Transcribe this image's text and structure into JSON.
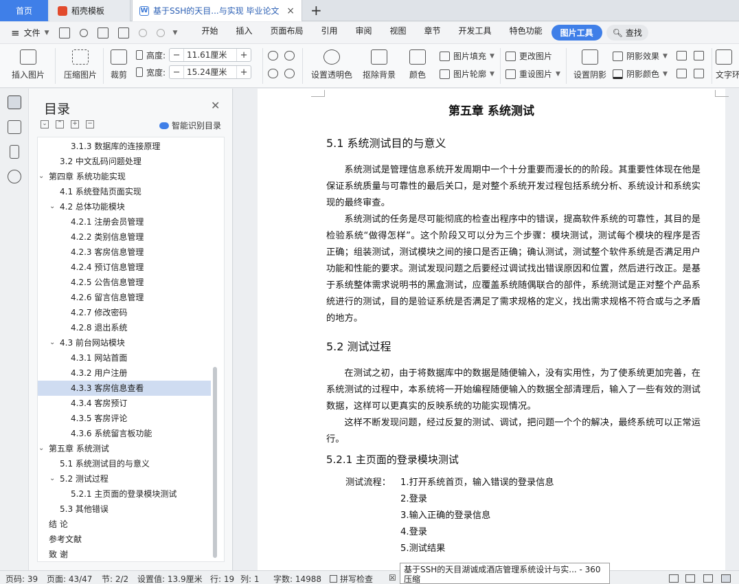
{
  "tabs": {
    "home": "首页",
    "templates": "稻壳模板",
    "document": "基于SSH的天目...与实现 毕业论文",
    "close": "×",
    "add": "+"
  },
  "menu": {
    "file": "文件",
    "items": [
      "开始",
      "插入",
      "页面布局",
      "引用",
      "审阅",
      "视图",
      "章节",
      "开发工具",
      "特色功能"
    ],
    "active_tab": "图片工具",
    "search": "查找"
  },
  "ribbon": {
    "insert_image": "插入图片",
    "compress": "压缩图片",
    "crop": "裁剪",
    "height_label": "高度:",
    "height_value": "11.61厘米",
    "width_label": "宽度:",
    "width_value": "15.24厘米",
    "transparent": "设置透明色",
    "remove_bg": "抠除背景",
    "color": "颜色",
    "fill": "图片填充",
    "outline": "图片轮廓",
    "change": "更改图片",
    "reset": "重设图片",
    "shadow": "设置阴影",
    "shadow_effect": "阴影效果",
    "shadow_color": "阴影颜色",
    "text_wrap": "文字环"
  },
  "toc": {
    "title": "目录",
    "ai_label": "智能识别目录",
    "items": [
      {
        "label": "3.1.3 数据库的连接原理",
        "level": 3
      },
      {
        "label": "3.2 中文乱码问题处理",
        "level": 2
      },
      {
        "label": "第四章  系统功能实现",
        "level": 1,
        "expanded": true
      },
      {
        "label": "4.1 系统登陆页面实现",
        "level": 2
      },
      {
        "label": "4.2 总体功能模块",
        "level": 2,
        "expanded": true
      },
      {
        "label": "4.2.1 注册会员管理",
        "level": 3
      },
      {
        "label": "4.2.2 类别信息管理",
        "level": 3
      },
      {
        "label": "4.2.3 客房信息管理",
        "level": 3
      },
      {
        "label": "4.2.4 预订信息管理",
        "level": 3
      },
      {
        "label": "4.2.5 公告信息管理",
        "level": 3
      },
      {
        "label": "4.2.6 留言信息管理",
        "level": 3
      },
      {
        "label": "4.2.7 修改密码",
        "level": 3
      },
      {
        "label": "4.2.8 退出系统",
        "level": 3
      },
      {
        "label": "4.3 前台网站模块",
        "level": 2,
        "expanded": true
      },
      {
        "label": "4.3.1 网站首面",
        "level": 3
      },
      {
        "label": "4.3.2 用户注册",
        "level": 3
      },
      {
        "label": "4.3.3 客房信息查看",
        "level": 3,
        "selected": true
      },
      {
        "label": "4.3.4 客房预订",
        "level": 3
      },
      {
        "label": "4.3.5 客房评论",
        "level": 3
      },
      {
        "label": "4.3.6 系统留言板功能",
        "level": 3
      },
      {
        "label": "第五章  系统测试",
        "level": 1,
        "expanded": true
      },
      {
        "label": "5.1 系统测试目的与意义",
        "level": 2
      },
      {
        "label": "5.2 测试过程",
        "level": 2,
        "expanded": true
      },
      {
        "label": "5.2.1 主页面的登录模块测试",
        "level": 3
      },
      {
        "label": "5.3 其他错误",
        "level": 2
      },
      {
        "label": "结   论",
        "level": 1
      },
      {
        "label": "参考文献",
        "level": 1
      },
      {
        "label": " 致   谢",
        "level": 1
      }
    ]
  },
  "document": {
    "chapter": "第五章  系统测试",
    "s51": "5.1 系统测试目的与意义",
    "p1": "系统测试是管理信息系统开发周期中一个十分重要而漫长的的阶段。其重要性体现在他是保证系统质量与可靠性的最后关口，是对整个系统开发过程包括系统分析、系统设计和系统实现的最终审查。",
    "p2": "系统测试的任务是尽可能彻底的检查出程序中的错误，提高软件系统的可靠性，其目的是检验系统“做得怎样”。这个阶段又可以分为三个步骤：模块测试，测试每个模块的程序是否正确；组装测试，测试模块之间的接口是否正确；确认测试，测试整个软件系统是否满足用户功能和性能的要求。测试发现问题之后要经过调试找出错误原因和位置，然后进行改正。是基于系统整体需求说明书的黑盒测试，应覆盖系统随偶联合的部件，系统测试是正对整个产品系统进行的测试，目的是验证系统是否满足了需求规格的定义，找出需求规格不符合或与之矛盾的地方。",
    "s52": "5.2 测试过程",
    "p3": "在测试之初，由于将数据库中的数据是随便输入，没有实用性，为了使系统更加完善，在系统测试的过程中，本系统将一开始编程随便输入的数据全部清理后，输入了一些有效的测试数据，这样可以更真实的反映系统的功能实现情况。",
    "p4": "这样不断发现问题，经过反复的测试、调试，把问题一个个的解决，最终系统可以正常运行。",
    "s521": "5.2.1 主页面的登录模块测试",
    "flow_label": "测试流程：",
    "steps": [
      "1.打开系统首页，输入错误的登录信息",
      "2.登录",
      "3.输入正确的登录信息",
      "4.登录",
      "5.测试结果"
    ]
  },
  "status": {
    "page_code": "页码: 39",
    "pages": "页面: 43/47",
    "section": "节: 2/2",
    "setting": "设置值: 13.9厘米",
    "row": "行: 19",
    "col": "列: 1",
    "words": "字数: 14988",
    "spell": "拼写检查"
  },
  "tooltip": "基于SSH的天目湖诚成酒店管理系统设计与实... - 360压缩"
}
